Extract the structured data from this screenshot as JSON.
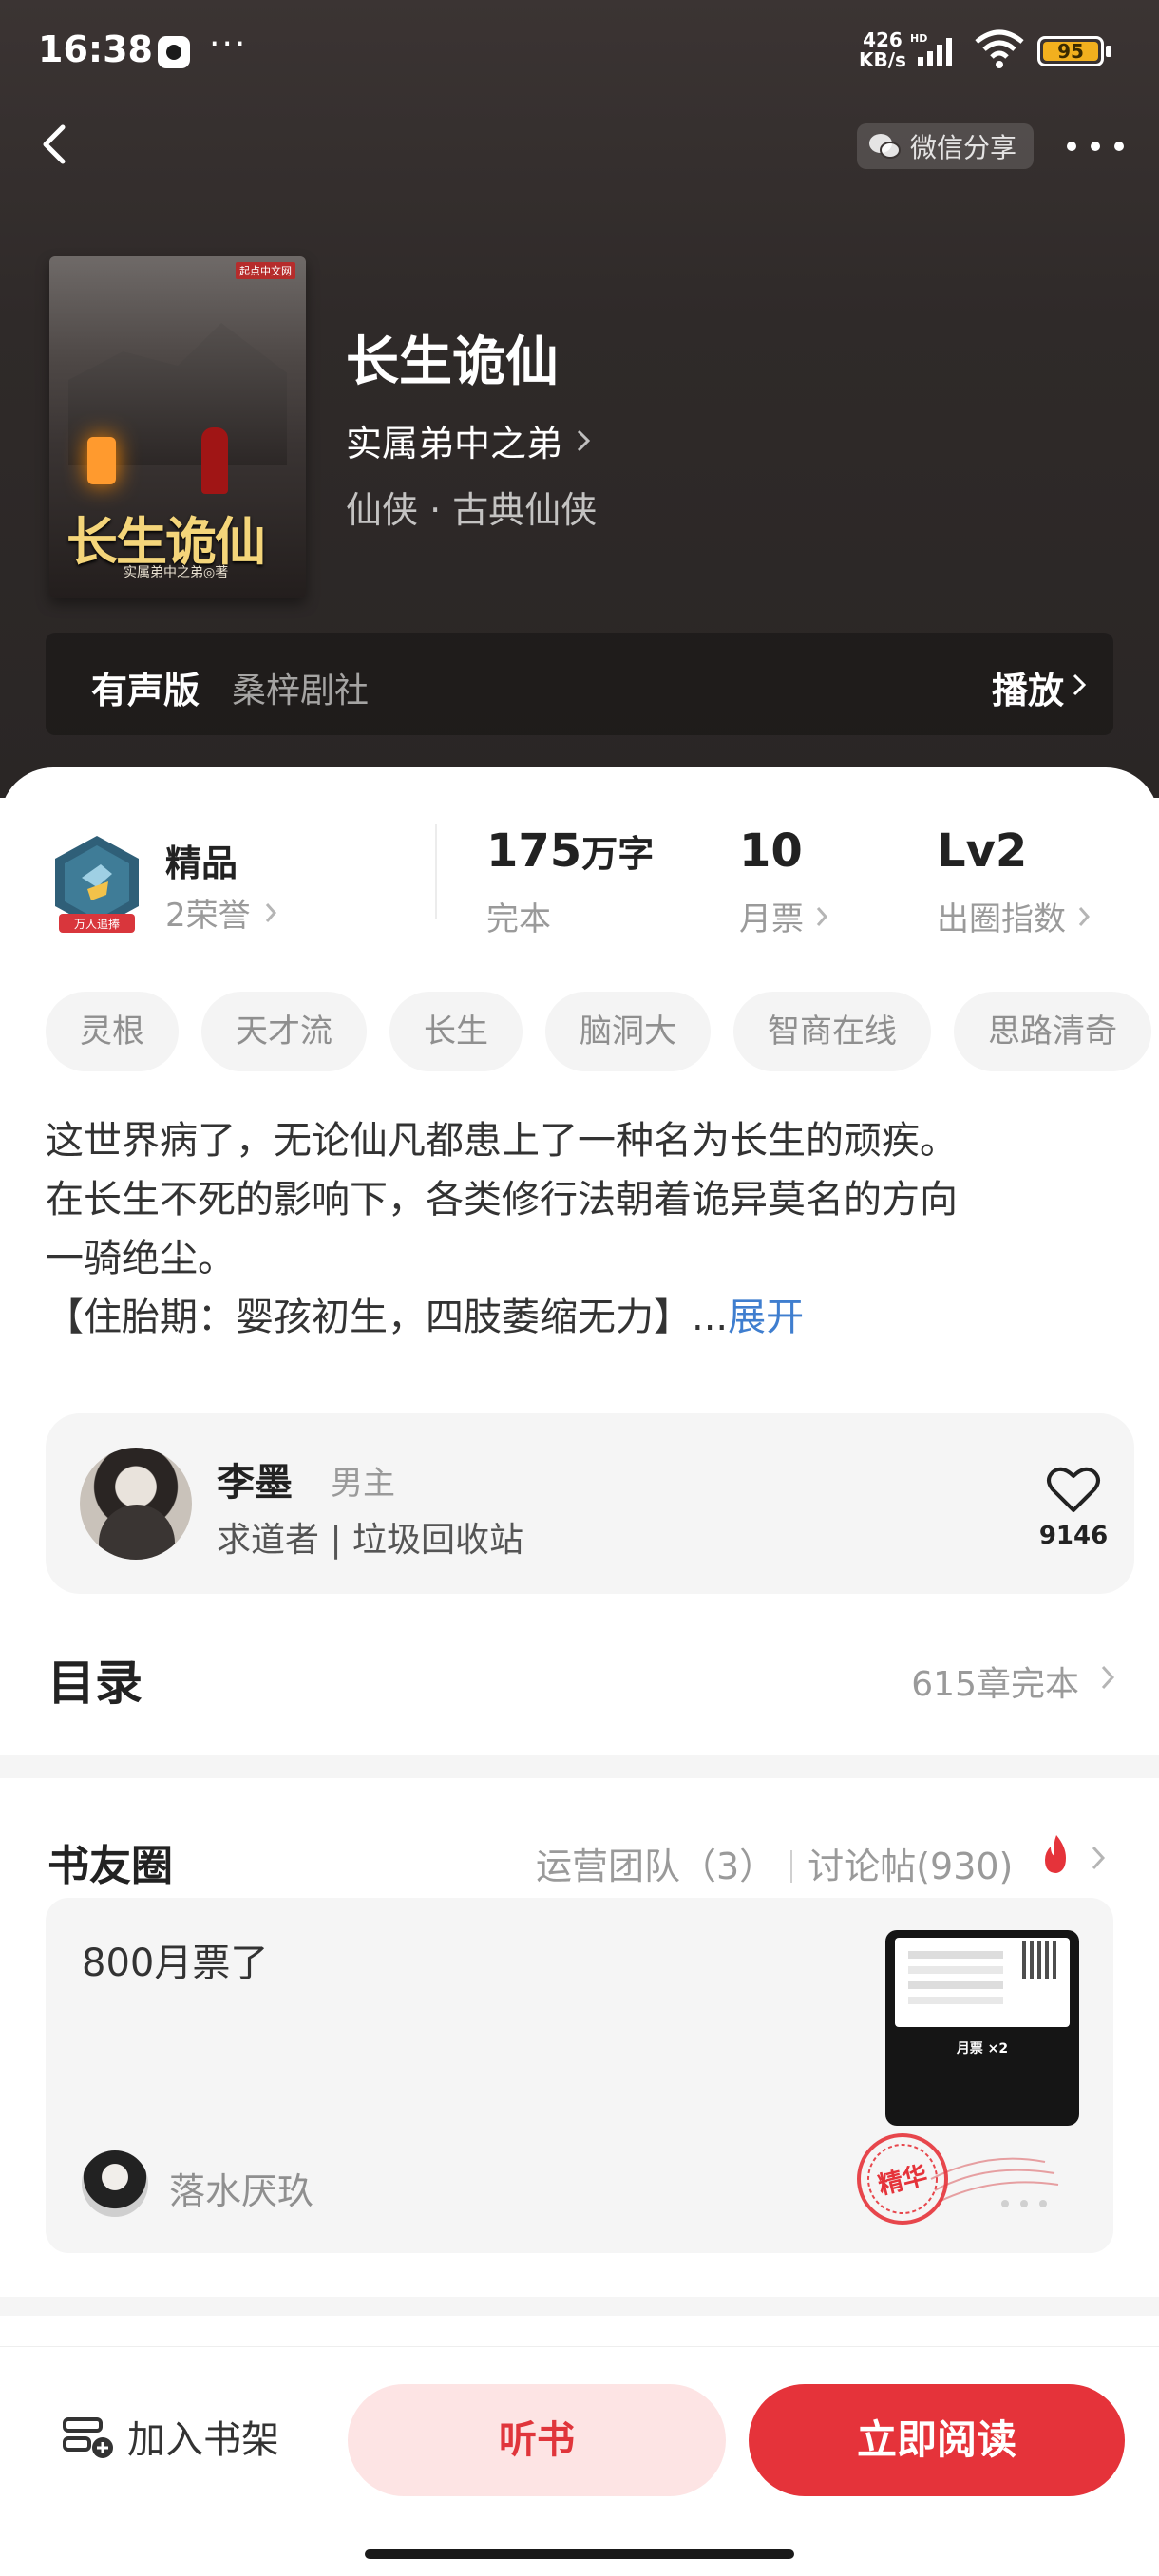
{
  "status_bar": {
    "time": "16:38",
    "dots": "···",
    "net_speed_top": "426",
    "net_speed_bottom": "KB/s",
    "battery": "95"
  },
  "header": {
    "share_label": "微信分享",
    "book_title": "长生诡仙",
    "author": "实属弟中之弟",
    "genre": "仙侠 · 古典仙侠",
    "cover_title": "长生诡仙",
    "cover_author": "实属弟中之弟◎著",
    "cover_badge": "起点中文网"
  },
  "audio": {
    "label": "有声版",
    "studio": "桑梓剧社",
    "play": "播放"
  },
  "stats": {
    "honor_title": "精品",
    "honor_sub": "2荣誉",
    "badge_text": "万人追捧",
    "words_value": "175",
    "words_unit": "万字",
    "words_sub": "完本",
    "tickets_value": "10",
    "tickets_sub": "月票",
    "level_value": "Lv2",
    "level_sub": "出圈指数"
  },
  "tags": [
    "灵根",
    "天才流",
    "长生",
    "脑洞大",
    "智商在线",
    "思路清奇"
  ],
  "synopsis": {
    "line1": "这世界病了，无论仙凡都患上了一种名为长生的顽疾。",
    "line2": "在长生不死的影响下，各类修行法朝着诡异莫名的方向",
    "line3": "一骑绝尘。",
    "line4": "【住胎期：婴孩初生，四肢萎缩无力】...",
    "expand": "展开"
  },
  "character": {
    "name": "李墨",
    "role": "男主",
    "desc": "求道者 | 垃圾回收站",
    "likes": "9146"
  },
  "toc": {
    "title": "目录",
    "count": "615章完本"
  },
  "circle": {
    "title": "书友圈",
    "team": "运营团队（3）",
    "posts": "讨论帖(930)",
    "post_text": "800月票了",
    "post_user": "落水厌玖",
    "ticket_text": "月票 ×2",
    "stamp_text": "精华"
  },
  "bottom": {
    "shelf": "加入书架",
    "listen": "听书",
    "read": "立即阅读"
  },
  "colors": {
    "accent": "#e5333a",
    "accent_light": "#fde4e4",
    "link": "#3f7ecf",
    "header_bg": "#2f2a29"
  }
}
